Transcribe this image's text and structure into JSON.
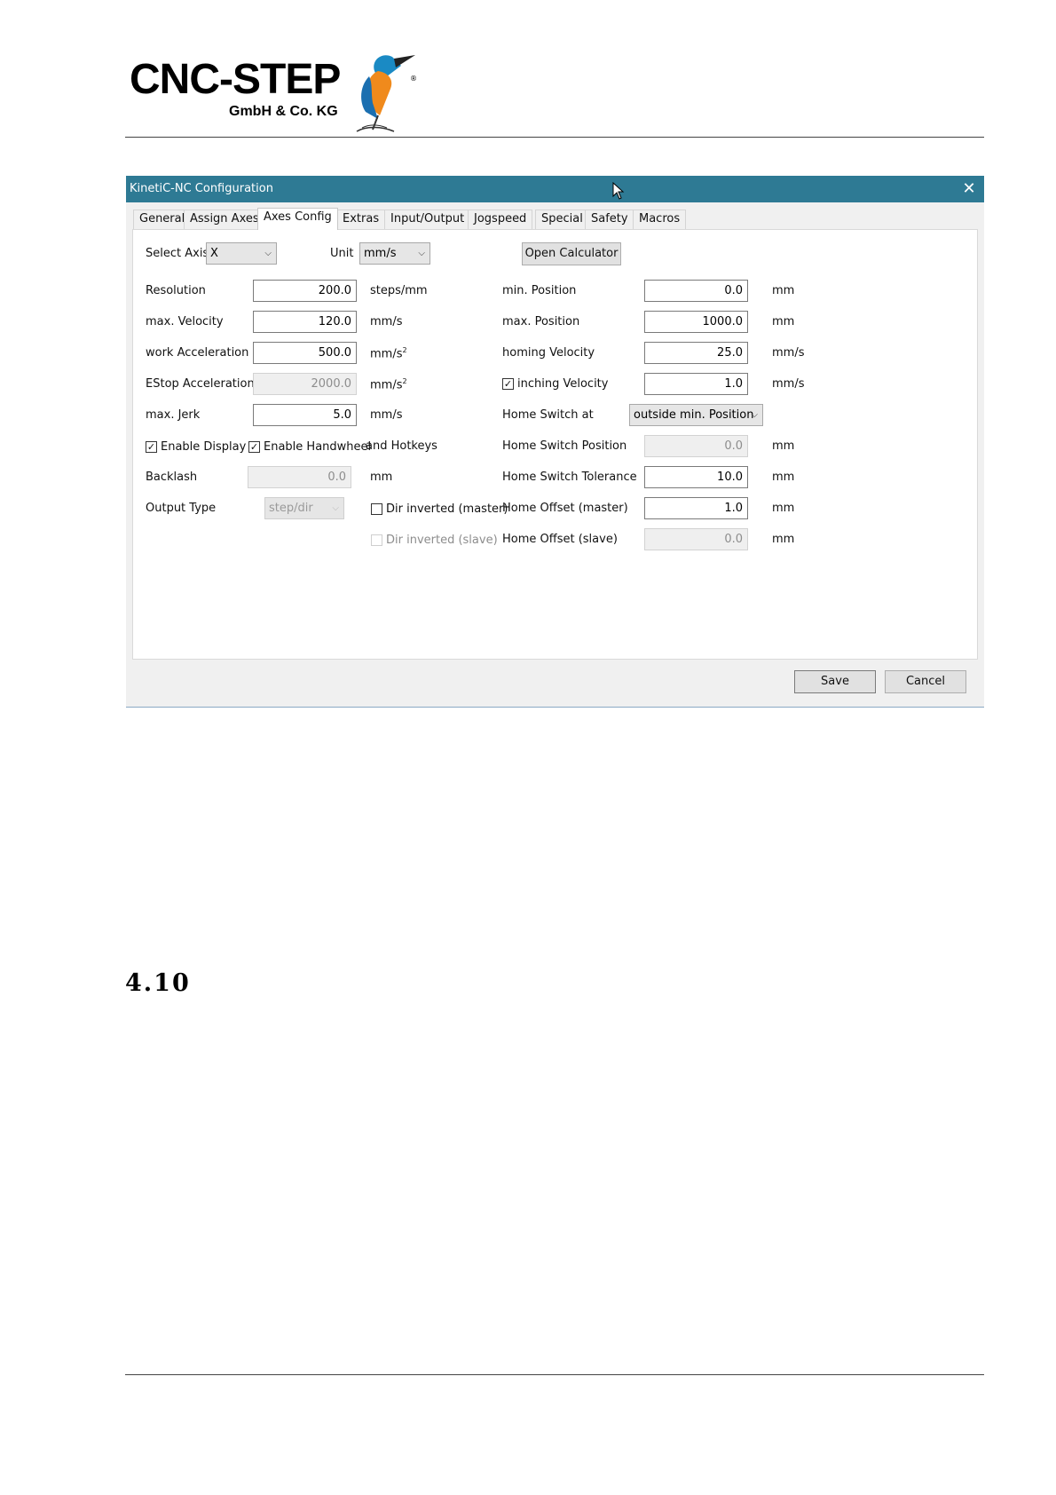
{
  "logo": {
    "name": "CNC-STEP",
    "subtitle": "GmbH & Co. KG",
    "registered": "®"
  },
  "section": {
    "heading": "4.10"
  },
  "dialog": {
    "title": "KinetiC-NC Configuration",
    "close_icon": "close-icon",
    "tabs": [
      "General",
      "Assign Axes",
      "Axes Config",
      "Extras",
      "Input/Output",
      "Jogspeed",
      "Special",
      "Safety",
      "Macros"
    ],
    "active_tab": "Axes Config",
    "select_axis": {
      "label": "Select Axis",
      "value": "X"
    },
    "unit": {
      "label": "Unit",
      "value": "mm/s"
    },
    "open_calculator": "Open Calculator",
    "left": {
      "resolution": {
        "label": "Resolution",
        "value": "200.0",
        "unit": "steps/mm"
      },
      "max_velocity": {
        "label": "max. Velocity",
        "value": "120.0",
        "unit": "mm/s"
      },
      "work_acceleration": {
        "label": "work Acceleration",
        "value": "500.0",
        "unit": "mm/s",
        "unit_sup": "2"
      },
      "estop_acceleration": {
        "label": "EStop Acceleration",
        "value": "2000.0",
        "unit": "mm/s",
        "unit_sup": "2"
      },
      "max_jerk": {
        "label": "max. Jerk",
        "value": "5.0",
        "unit": "mm/s"
      },
      "enable_display": {
        "label": "Enable Display",
        "checked": true
      },
      "enable_handwheel": {
        "label": "Enable Handwheel",
        "checked": true
      },
      "and_hotkeys": "and Hotkeys",
      "backlash": {
        "label": "Backlash",
        "value": "0.0",
        "unit": "mm"
      },
      "output_type": {
        "label": "Output Type",
        "value": "step/dir"
      },
      "dir_inverted_master": {
        "label": "Dir inverted (master)",
        "checked": false
      },
      "dir_inverted_slave": {
        "label": "Dir inverted (slave)",
        "checked": false
      }
    },
    "right": {
      "min_position": {
        "label": "min. Position",
        "value": "0.0",
        "unit": "mm"
      },
      "max_position": {
        "label": "max. Position",
        "value": "1000.0",
        "unit": "mm"
      },
      "homing_velocity": {
        "label": "homing Velocity",
        "value": "25.0",
        "unit": "mm/s"
      },
      "inching_velocity": {
        "label": "inching Velocity",
        "value": "1.0",
        "unit": "mm/s",
        "checked": true
      },
      "home_switch_at": {
        "label": "Home Switch at",
        "value": "outside min. Position"
      },
      "home_switch_position": {
        "label": "Home Switch Position",
        "value": "0.0",
        "unit": "mm"
      },
      "home_switch_tolerance": {
        "label": "Home Switch Tolerance",
        "value": "10.0",
        "unit": "mm"
      },
      "home_offset_master": {
        "label": "Home Offset (master)",
        "value": "1.0",
        "unit": "mm"
      },
      "home_offset_slave": {
        "label": "Home Offset (slave)",
        "value": "0.0",
        "unit": "mm"
      }
    },
    "save": "Save",
    "cancel": "Cancel"
  }
}
